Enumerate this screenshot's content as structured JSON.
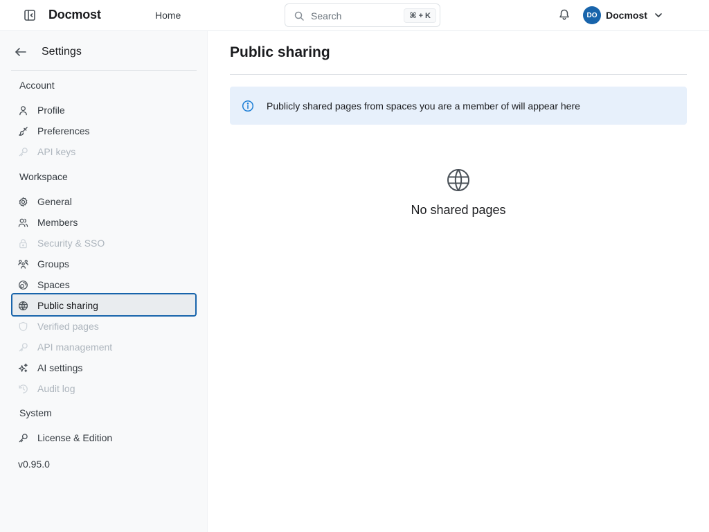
{
  "header": {
    "app_name": "Docmost",
    "home_label": "Home",
    "search": {
      "placeholder": "Search",
      "shortcut": "⌘ + K"
    },
    "user": {
      "initials": "DO",
      "name": "Docmost"
    },
    "icons": [
      "sidebar-toggle-icon",
      "search-icon",
      "bell-icon",
      "chevron-down-icon"
    ]
  },
  "sidebar": {
    "title": "Settings",
    "sections": {
      "account": "Account",
      "workspace": "Workspace",
      "system": "System"
    },
    "items": {
      "profile": {
        "label": "Profile",
        "icon": "user-icon",
        "disabled": false
      },
      "preferences": {
        "label": "Preferences",
        "icon": "brush-icon",
        "disabled": false
      },
      "api_keys": {
        "label": "API keys",
        "icon": "key-icon",
        "disabled": true
      },
      "general": {
        "label": "General",
        "icon": "gear-icon",
        "disabled": false
      },
      "members": {
        "label": "Members",
        "icon": "users-icon",
        "disabled": false
      },
      "security_sso": {
        "label": "Security & SSO",
        "icon": "lock-icon",
        "disabled": true
      },
      "groups": {
        "label": "Groups",
        "icon": "users-group-icon",
        "disabled": false
      },
      "spaces": {
        "label": "Spaces",
        "icon": "spaces-icon",
        "disabled": false
      },
      "public_sharing": {
        "label": "Public sharing",
        "icon": "globe-icon",
        "active": true
      },
      "verified_pages": {
        "label": "Verified pages",
        "icon": "shield-check-icon",
        "disabled": true
      },
      "api_management": {
        "label": "API management",
        "icon": "key-icon",
        "disabled": true
      },
      "ai_settings": {
        "label": "AI settings",
        "icon": "sparkles-icon",
        "disabled": false
      },
      "audit_log": {
        "label": "Audit log",
        "icon": "history-icon",
        "disabled": true
      },
      "license": {
        "label": "License & Edition",
        "icon": "key-icon",
        "disabled": false
      }
    },
    "version": "v0.95.0"
  },
  "main": {
    "title": "Public sharing",
    "info_message": "Publicly shared pages from spaces you are a member of will appear here",
    "empty_state": {
      "icon": "globe-icon",
      "title": "No shared pages"
    }
  },
  "colors": {
    "accent": "#1864ab",
    "info_bg": "#e7f0fb",
    "info_icon": "#1c7ed6",
    "sidebar_bg": "#f8f9fa"
  }
}
